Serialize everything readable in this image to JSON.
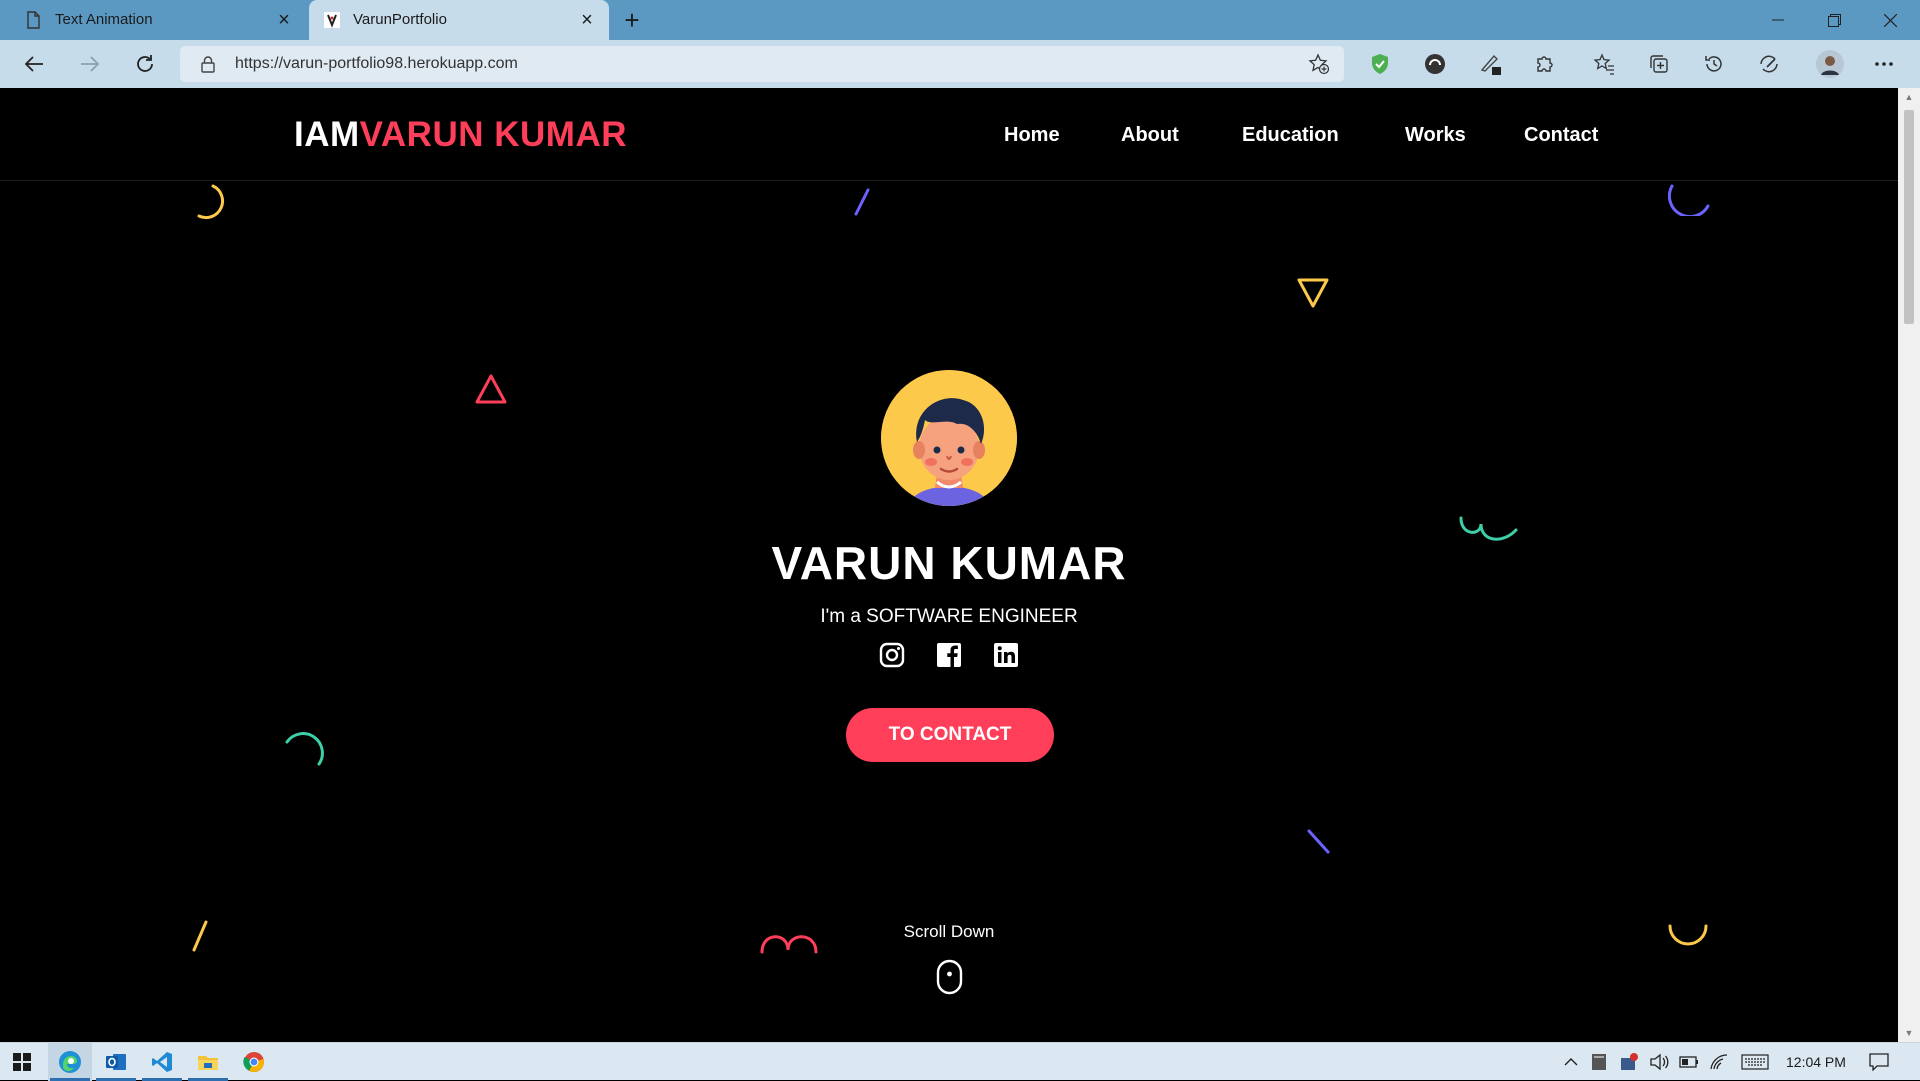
{
  "browser": {
    "tabs": [
      {
        "title": "Text Animation",
        "active": false,
        "icon": "page-icon"
      },
      {
        "title": "VarunPortfolio",
        "active": true,
        "icon": "site-favicon"
      }
    ],
    "new_tab_label": "+",
    "url": "https://varun-portfolio98.herokuapp.com",
    "toolbar_icons": [
      "shield-extension-icon",
      "extension-icon",
      "pen-extension-icon",
      "extensions-icon",
      "favorites-icon",
      "collections-icon",
      "history-icon",
      "performance-icon",
      "profile-avatar",
      "more-icon"
    ]
  },
  "page": {
    "logo": {
      "part1": "IAM",
      "part2": "VARUN KUMAR"
    },
    "nav": [
      "Home",
      "About",
      "Education",
      "Works",
      "Contact"
    ],
    "hero": {
      "name": "VARUN KUMAR",
      "role": "I'm a SOFTWARE ENGINEER",
      "socials": [
        "instagram-icon",
        "facebook-icon",
        "linkedin-icon"
      ],
      "cta": "TO CONTACT",
      "scroll_label": "Scroll Down"
    },
    "colors": {
      "accent": "#ff3e5a",
      "yellow": "#fdc94a",
      "blue": "#6c63ff",
      "teal": "#3ecfa8",
      "background": "#000000"
    }
  },
  "taskbar": {
    "apps": [
      "windows-start-icon",
      "edge-icon",
      "outlook-icon",
      "vscode-icon",
      "file-explorer-icon",
      "chrome-icon"
    ],
    "time": "12:04 PM"
  }
}
